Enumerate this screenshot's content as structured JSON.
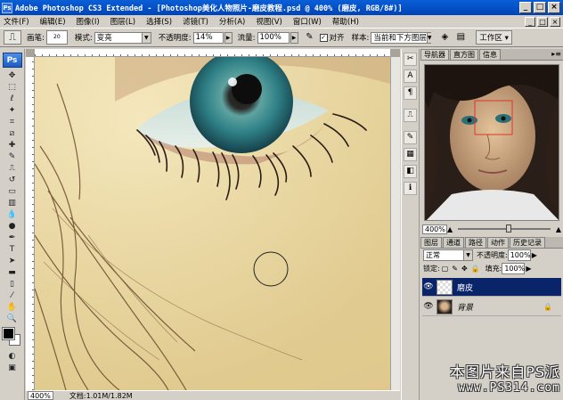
{
  "window": {
    "icon": "Ps",
    "title": "Adobe Photoshop CS3 Extended - [Photoshop美化人物照片-磨皮教程.psd @ 400% (磨皮, RGB/8#)]",
    "controls": [
      "_",
      "□",
      "×"
    ]
  },
  "menu": [
    "文件(F)",
    "编辑(E)",
    "图像(I)",
    "图层(L)",
    "选择(S)",
    "滤镜(T)",
    "分析(A)",
    "视图(V)",
    "窗口(W)",
    "帮助(H)"
  ],
  "options": {
    "brush_label": "画笔:",
    "brush_size": "20",
    "mode_label": "模式:",
    "mode_value": "变亮",
    "opacity_label": "不透明度:",
    "opacity_value": "14%",
    "flow_label": "流量:",
    "flow_value": "100%",
    "aligned_label": "对齐",
    "aligned_checked": "✓",
    "sample_label": "样本:",
    "sample_value": "当前和下方图层",
    "workspace_label": "工作区"
  },
  "statusbar": {
    "zoom": "400%",
    "doc_info": "文档:1.01M/1.82M"
  },
  "navigator": {
    "tabs": [
      "导航器",
      "直方图",
      "信息"
    ],
    "zoom": "400%",
    "zoom_level": 0.55
  },
  "layers": {
    "tabs": [
      "图层",
      "通道",
      "路径",
      "动作",
      "历史记录"
    ],
    "blend_mode": "正常",
    "opacity_label": "不透明度:",
    "opacity_value": "100%",
    "lock_label": "锁定:",
    "fill_label": "填充:",
    "fill_value": "100%",
    "items": [
      {
        "name": "磨皮",
        "selected": true
      },
      {
        "name": "背景",
        "selected": false
      }
    ]
  },
  "watermark": {
    "line1": "本图片来自PS派",
    "line2": "www.PS314.com"
  },
  "colors": {
    "title_bar": "#0043b8",
    "selected_layer": "#0a246a",
    "skin": "#ecdba4",
    "iris": "#2e7f86"
  }
}
